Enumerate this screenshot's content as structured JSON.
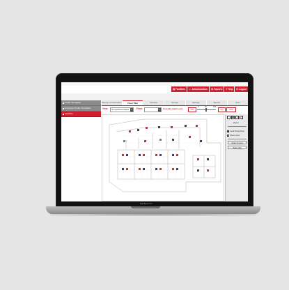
{
  "device": {
    "label": "MacBook Pro"
  },
  "topnav": {
    "items": [
      {
        "label": "Facilities",
        "icon": "building-icon"
      },
      {
        "label": "Administration",
        "icon": "person-icon"
      },
      {
        "label": "Reports",
        "icon": "report-icon"
      },
      {
        "label": "Help",
        "icon": "help-icon"
      },
      {
        "label": "Logout",
        "icon": "power-icon"
      }
    ]
  },
  "sidebar": {
    "items": [
      {
        "label": "Profile Templates"
      },
      {
        "label": "Employee Profile Templates"
      },
      {
        "label": "Facilities"
      }
    ]
  },
  "tabs": [
    {
      "label": "Energy Consumption"
    },
    {
      "label": "Floor Plan"
    },
    {
      "label": "Devices"
    },
    {
      "label": "Groups"
    },
    {
      "label": "Settings"
    },
    {
      "label": "Events"
    },
    {
      "label": "Activ"
    }
  ],
  "controls": {
    "view_label": "View:",
    "view_value": "Occupational Status",
    "floor_label": "Floor:",
    "floor_value": "",
    "override_label": "Override Light Level:",
    "off_button": "OFF",
    "slider_min": "0",
    "slider_mid": "50",
    "slider_max": "100",
    "on_button": "ON",
    "auto_button": "Auto"
  },
  "panel": {
    "zoom_label": "Zoom",
    "lock_drag_label": "Lock Drag Drop",
    "show_grid_label": "Show Grid",
    "lock_drag_checked": true,
    "show_grid_checked": false,
    "snap_button": "Snap To Grid",
    "save_button": "Save (Alt)"
  },
  "colors": {
    "accent": "#cf2030",
    "sidebar_inactive": "#8b8b8b",
    "fixture_red": "#d7263d",
    "fixture_green": "#33b04a",
    "fixture_blue": "#2b3f8f"
  }
}
